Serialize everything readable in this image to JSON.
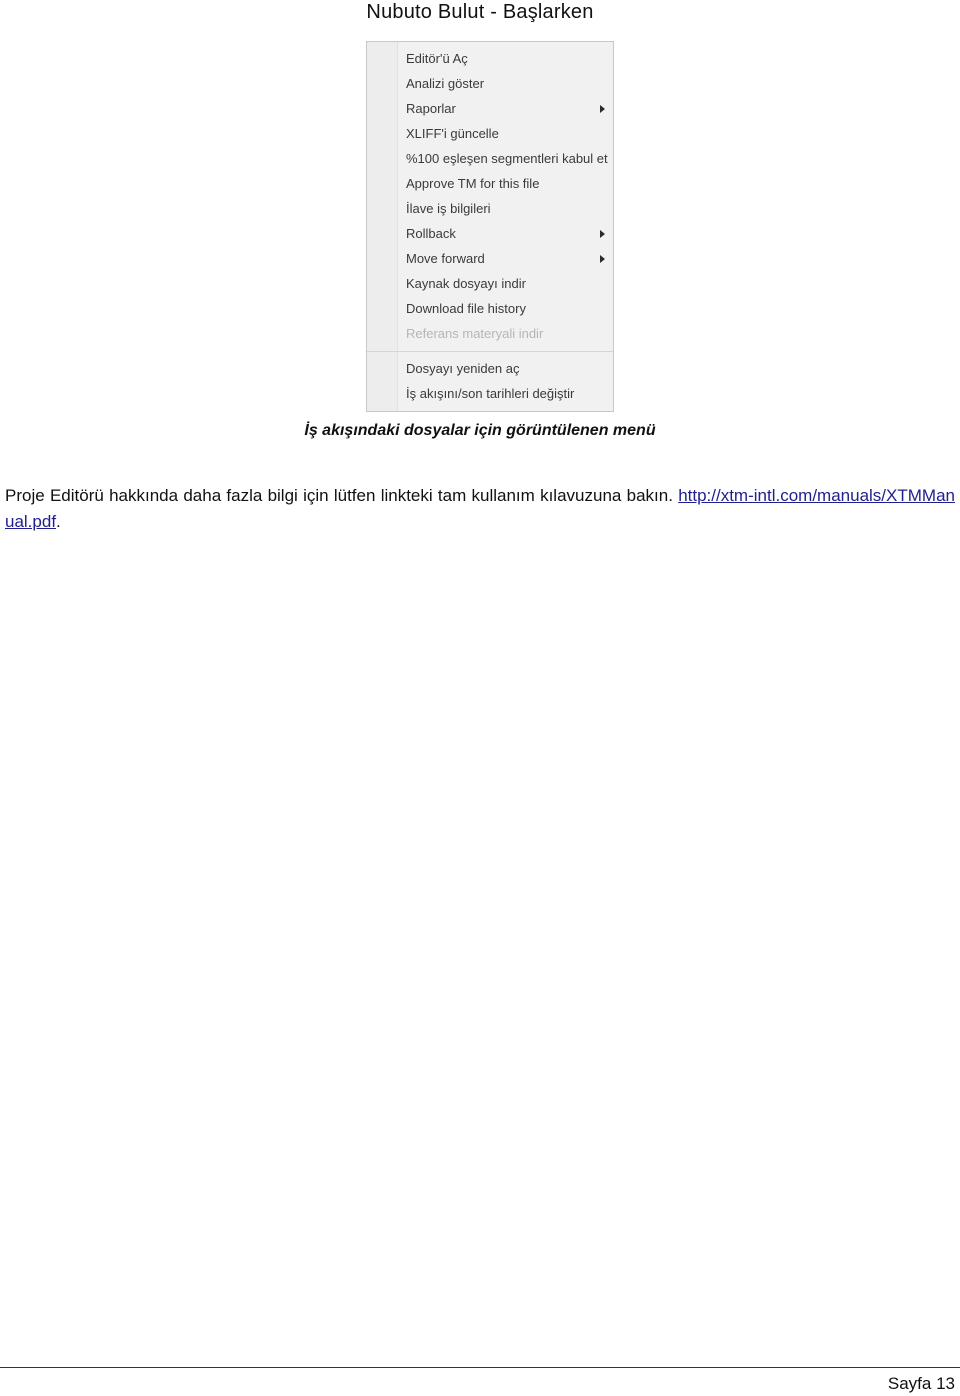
{
  "document": {
    "header_title": "Nubuto Bulut - Başlarken",
    "caption": "İş akışındaki dosyalar için görüntülenen menü",
    "footer_page_label": "Sayfa 13"
  },
  "body": {
    "paragraph_before_link": "Proje Editörü hakkında daha fazla bilgi için lütfen linkteki tam kullanım kılavuzuna bakın. ",
    "link_text": "http://xtm-intl.com/manuals/XTMManual.pdf",
    "paragraph_after_link": "."
  },
  "context_menu": {
    "groups": [
      {
        "items": [
          {
            "label": "Editör'ü Aç",
            "has_submenu": false,
            "disabled": false
          },
          {
            "label": "Analizi göster",
            "has_submenu": false,
            "disabled": false
          },
          {
            "label": "Raporlar",
            "has_submenu": true,
            "disabled": false
          },
          {
            "label": "XLIFF'i güncelle",
            "has_submenu": false,
            "disabled": false
          },
          {
            "label": "%100 eşleşen segmentleri kabul et",
            "has_submenu": false,
            "disabled": false
          },
          {
            "label": "Approve TM for this file",
            "has_submenu": false,
            "disabled": false
          },
          {
            "label": "İlave iş bilgileri",
            "has_submenu": false,
            "disabled": false
          },
          {
            "label": "Rollback",
            "has_submenu": true,
            "disabled": false
          },
          {
            "label": "Move forward",
            "has_submenu": true,
            "disabled": false
          },
          {
            "label": "Kaynak dosyayı indir",
            "has_submenu": false,
            "disabled": false
          },
          {
            "label": "Download file history",
            "has_submenu": false,
            "disabled": false
          },
          {
            "label": "Referans materyali indir",
            "has_submenu": false,
            "disabled": true
          }
        ]
      },
      {
        "items": [
          {
            "label": "Dosyayı yeniden aç",
            "has_submenu": false,
            "disabled": false
          },
          {
            "label": "İş akışını/son tarihleri değiştir",
            "has_submenu": false,
            "disabled": false
          }
        ]
      }
    ]
  },
  "colors": {
    "menu_background": "#f1f1f1",
    "menu_border": "#c8c8c8",
    "menu_text": "#3a3a3a",
    "menu_disabled_text": "#b6b6b6",
    "link": "#1f1f8f",
    "footer_rule": "#3b3125"
  }
}
